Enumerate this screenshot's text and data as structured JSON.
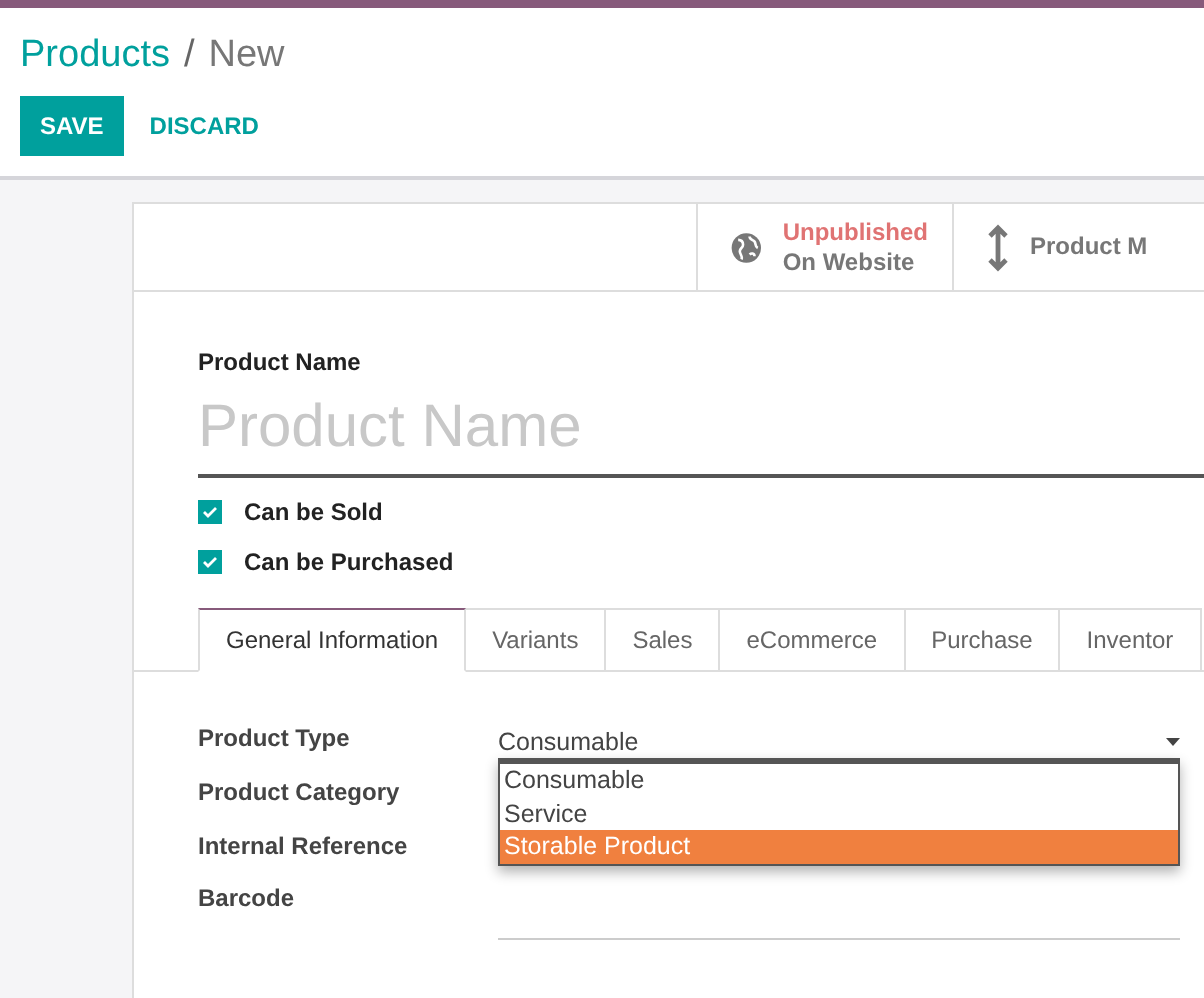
{
  "breadcrumb": {
    "parent": "Products",
    "separator": "/",
    "current": "New"
  },
  "buttons": [
    {
      "label": "SAVE",
      "kind": "primary"
    },
    {
      "label": "DISCARD",
      "kind": "link"
    }
  ],
  "stat_buttons": [
    {
      "kind": "publish",
      "status": "Unpublished",
      "label": "On Website"
    },
    {
      "kind": "measure",
      "label": "Product M"
    }
  ],
  "product_name": {
    "label": "Product Name",
    "placeholder": "Product Name"
  },
  "checkboxes": [
    {
      "label": "Can be Sold",
      "checked": true
    },
    {
      "label": "Can be Purchased",
      "checked": true
    }
  ],
  "tabs": [
    {
      "label": "General Information",
      "selected": true
    },
    {
      "label": "Variants",
      "selected": false
    },
    {
      "label": "Sales",
      "selected": false
    },
    {
      "label": "eCommerce",
      "selected": false
    },
    {
      "label": "Purchase",
      "selected": false
    },
    {
      "label": "Inventor",
      "selected": false
    }
  ],
  "fields": [
    {
      "label": "Product Type",
      "kind": "select",
      "value": "Consumable",
      "options": [
        {
          "label": "Consumable",
          "highlighted": false
        },
        {
          "label": "Service",
          "highlighted": false
        },
        {
          "label": "Storable Product",
          "highlighted": true
        }
      ]
    },
    {
      "label": "Product Category",
      "kind": "covered"
    },
    {
      "label": "Internal Reference",
      "kind": "covered"
    },
    {
      "label": "Barcode",
      "kind": "text"
    }
  ]
}
